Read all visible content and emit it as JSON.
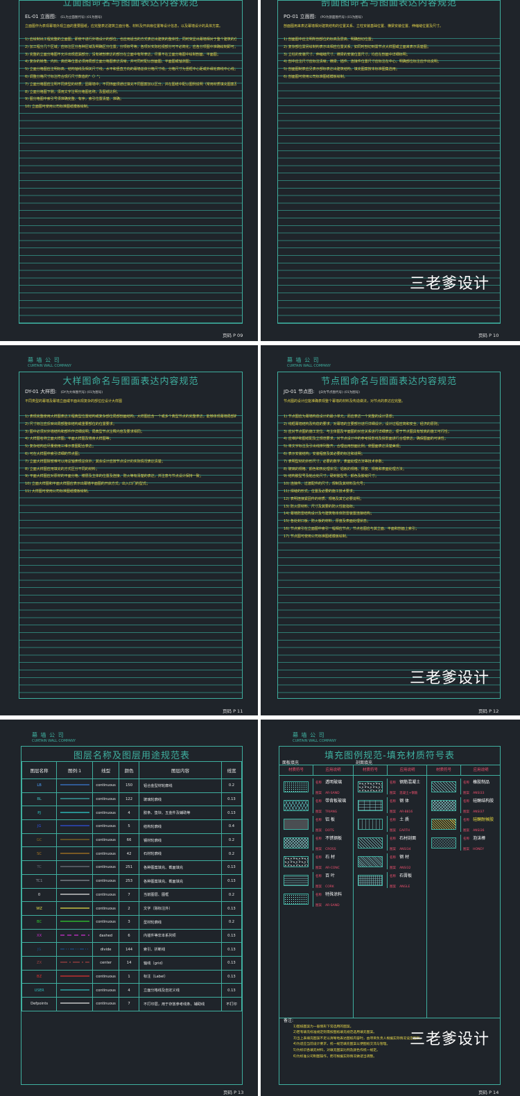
{
  "pages": {
    "p09": {
      "title": "立面图命名与图面表达内容规范",
      "code": "EL-01 立面图:",
      "code_note": "(EL为立面图代号) (01为图号)",
      "intro": "立面图作为表现幕墙外观立面的重要图纸，应完整表达建筑立面分格、材料及开启扇位置等设计信息，以及幕墙设计的具体方案。",
      "items": [
        "1) 应绘制出工程完整的立面图，即使不进行外墙设计的部位，也应用适当的方式表达出建筑的整体性，同时突显出幕墙相对于整个建筑的位置关系；",
        "2) 加工程分几个区域，应标注区分各种区域及明确区分位置，分项标号等，各项对实际检视部分可不必简化，应各分项图中准确绘制即可；",
        "3) 完整的立面分格图不允许出现遗漏部分，没有被剖表达的部分在立面中有所表达，尽量不在立面分格图中绘制剖面、平面图；",
        "4) 复杂的转角、内凹、高低等位置必须用局部立面分格图表达清晰，并可同时配以剖面图、平面图或轴测图；",
        "5) 立面分格图应注明标高、结构轴线及相关尺寸线，水平和竖直方向的幕墙总体分格尺寸线，分格尺寸为竖框中心距或外缘轮廓线中心线；",
        "6) 调整分格尺寸标注符合现行尺寸数值的\"（）\"；",
        "7) 立面分格图应注明不同类型的材质，因幕墙中，不同饰面须通过填充不同图案加以区分，并在图纸中配以图例说明（常用材质填充图案及填充图例规范）；",
        "8) 立面分格图下侧，须用文字注明分格图名称，及图纸比例；",
        "9) 图分格图中索引号须准确完整、有序，索引位置清楚、准确；",
        "10) 立面图可使用公司标准图纸模板绘制。"
      ],
      "page_no": "页码  P 09"
    },
    "p10": {
      "title": "剖面图命名与图面表达内容规范",
      "code": "PO-01 立面图:",
      "code_note": "(PO为剖面图代号) (01为图号)",
      "intro": "剖面图用来表达幕墙相对建筑结构的位置关系、立柱安装基础位置、横梁安装位置、伸缩缝位置及尺寸。",
      "items": [
        "1) 剖面图中应注明所剖部位的标高及层高、明确剖切位置；",
        "2) 复杂部位需另绘制构表示出相应位置关系，如同时剖切到需节点大样图或立面来表示清楚图；",
        "3) 立柱的安装尺寸、伸缩缝尺寸、横梁的安装位置尺寸，均应在剖面中详细标明；",
        "4) 剖中应注尺寸应标注清晰，横梁、插件、连接件位置尺寸应标注在中心，明确部位标注应作出说明；",
        "5) 剖面图制表应见表示部标表达出建筑结构，填充图案按本标准图集选用；",
        "6) 剖面图可使用公司标准图纸模板绘制。"
      ],
      "page_no": "页码  P 10"
    },
    "p11": {
      "company_cn": "幕 墙 公 司",
      "company_en": "CURTAIN WALL COMPANY",
      "title": "大样图命名与图面表达内容规范",
      "code": "DY-01 大样图:",
      "code_note": "(DY为大样图代号) (01为图号)",
      "intro": "不同类型的幕墙及幕墙立面或平面出现复杂的部位应设计大样图",
      "items": [
        "1) 表现完整使用大样图表达工程典型位置结构或复杂部位局部剖面结构，大样图应含一个或多个典型节点的完整表达，能够体现幕墙局部的整体结构；",
        "2) 尺寸标注应反映出局部整体结构或重要部位的位置要求；",
        "3) 图中必须对外墙结构和部件作详细说明，局典型节点注释内容及要求相同；",
        "4) 大样图名称立面大样图，平面大样图及墙身大样图等；",
        "5) 复杂结构应尽量使用三维示意图配合表达；",
        "6) 可在大样图中索引详细的节点图；",
        "7) 立面大样图除较难可以用总轴表现总体外，其余设计应按节点设计的实际情况表达清楚；",
        "8) 立面大样图应用填充的方式区分不同的材料；",
        "9) 平面大样图应对原材的平面分格、楼层及主体的位置及连接、防火等有清楚的表达，并注意与节点设计保持一致；",
        "10) 立面大样图和平面大样图应表示出幕墙平面图的开启方式，出入口门的型式；",
        "11) 大样图可使用公司标准图纸模板绘制。"
      ],
      "page_no": "页码  P 11"
    },
    "p12": {
      "company_cn": "幕 墙 公 司",
      "company_en": "CURTAIN WALL COMPANY",
      "title": "节点图命名与图面表达内容规范",
      "code": "JD-01 节点图:",
      "code_note": "(JD为节点图代号) (01为图号)",
      "intro": "节点图的设计应能准确表现整个幕墙的材料及构造做法，对节点的表达应完整。",
      "items": [
        "1) 节点图应为幕墙构造设计的最小单元，而应表达一个完整的设计思想；",
        "2) 线框幕墙结构及构造的要求，对幕墙的主要部分进行详细设计，设计过程应简和安全、经济的原则；",
        "3) 应对节点图的施工定位、与主体图及平面图的对应关系进行详细表达，便于节点图具有较高的施工可行性；",
        "4) 应维护和图纸配及立规范要求，对节点设计中的参考投影线及投影面进行合理表达，确保图面的可读性；",
        "5) 将文字标注及引出线排列整齐，合理运用剖面比例，使图面表达清楚美观；",
        "6) 表示安装结构，安装程度及其必要的标注和说明；",
        "7) 表明型材的外形尺寸，必要的数字，表面处理方法等技术参数；",
        "8) 玻璃的规格、颜色和热处理状况；铝板的规格、厚度、规格和表面处理方法；",
        "9) 结构胶型号及粘合处尺寸，硬封胶型号、颜色及胶缝尺寸；",
        "10) 连接件、过渡配件的尺寸，规制及其材料及代号；",
        "11) 焊缝的形式，位置及必要的施工技术要求；",
        "12) 表明连接紧固件的材质、规格及其它必要说明；",
        "13) 防火层材料、尺寸及其要的防火性能指标；",
        "14) 幕墙防雷结构设计及与建筑物本体防雷装置连接结构；",
        "15) 各处封口板、防火板的材料，厚度及表面处理状态；",
        "16) 节点索引在立面图中索引一幅相应节点，节点名图应与其立面、平面和剖面上索引；",
        "17) 节点图可使用公司标准图纸模板绘制。"
      ],
      "page_no": "页码  P 12"
    },
    "p13": {
      "company_cn": "幕 墙 公 司",
      "company_en": "CURTAIN WALL COMPANY",
      "title": "图层名称及图层用途规范表",
      "headers": [
        "图层名称",
        "图例:1",
        "线型",
        "颜色",
        "图层内容",
        "线宽"
      ],
      "rows": [
        {
          "name": "LB",
          "name_color": "#4aa0ff",
          "line_color": "#3a7bd5",
          "dash": "solid",
          "linetype": "continuous",
          "color_no": "150",
          "content": "铝合金型材轮廓线",
          "width": "0.2"
        },
        {
          "name": "BL",
          "name_color": "#3fc0c0",
          "line_color": "#3fb0b0",
          "dash": "solid",
          "linetype": "continuous",
          "color_no": "122",
          "content": "玻璃轮廓线",
          "width": "0.13"
        },
        {
          "name": "PJ",
          "name_color": "#2fd0d0",
          "line_color": "#2fd0d0",
          "dash": "solid",
          "linetype": "continuous",
          "color_no": "4",
          "content": "胶条、垫块、五金件及辅助等",
          "width": "0.13"
        },
        {
          "name": "JG",
          "name_color": "#3050e0",
          "line_color": "#3050e0",
          "dash": "solid",
          "linetype": "continuous",
          "color_no": "5",
          "content": "结构轮廓线",
          "width": "0.4"
        },
        {
          "name": "GC",
          "name_color": "#8a6a20",
          "line_color": "#8a6a20",
          "dash": "solid",
          "linetype": "continuous",
          "color_no": "66",
          "content": "钢材轮廓线",
          "width": "0.2"
        },
        {
          "name": "SC",
          "name_color": "#b07a20",
          "line_color": "#b07a20",
          "dash": "solid",
          "linetype": "continuous",
          "color_no": "42",
          "content": "石材轮廓线",
          "width": "0.2"
        },
        {
          "name": "TC",
          "name_color": "#606870",
          "line_color": "#707880",
          "dash": "solid",
          "linetype": "continuous",
          "color_no": "251",
          "content": "各种图案填充、截面填充",
          "width": "0.13"
        },
        {
          "name": "TC1",
          "name_color": "#8a9098",
          "line_color": "#8a9098",
          "dash": "solid",
          "linetype": "continuous",
          "color_no": "253",
          "content": "各种图案填充、截面填充",
          "width": "0.13"
        },
        {
          "name": "0",
          "name_color": "#e8e8e8",
          "line_color": "#e8e8e8",
          "dash": "solid",
          "linetype": "continuous",
          "color_no": "7",
          "content": "当前图层、图框",
          "width": "0.2"
        },
        {
          "name": "WZ",
          "name_color": "#e8e04a",
          "line_color": "#e8e04a",
          "dash": "solid",
          "linetype": "continuous",
          "color_no": "2",
          "content": "文字（除标注外）",
          "width": "0.13"
        },
        {
          "name": "BC",
          "name_color": "#30d030",
          "line_color": "#30d030",
          "dash": "solid",
          "linetype": "continuous",
          "color_no": "3",
          "content": "型材轮廓线",
          "width": "0.2"
        },
        {
          "name": "XX",
          "name_color": "#d030d0",
          "line_color": "#d030d0",
          "dash": "dashed",
          "linetype": "dashed",
          "color_no": "6",
          "content": "内插件等非本系列项",
          "width": "0.13"
        },
        {
          "name": "JG",
          "name_color": "#1a4a80",
          "line_color": "#1a4a80",
          "dash": "divide",
          "linetype": "divide",
          "color_no": "144",
          "content": "索引、折断线",
          "width": "0.13"
        },
        {
          "name": "ZX",
          "name_color": "#a04040",
          "line_color": "#a04040",
          "dash": "center",
          "linetype": "center",
          "color_no": "14",
          "content": "轴线（grid）",
          "width": "0.13"
        },
        {
          "name": "BZ",
          "name_color": "#e03030",
          "line_color": "#e03030",
          "dash": "solid",
          "linetype": "continuous",
          "color_no": "1",
          "content": "标注（Label）",
          "width": "0.13"
        },
        {
          "name": "USER",
          "name_color": "#30c0c0",
          "line_color": "#30c0c0",
          "dash": "solid",
          "linetype": "continuous",
          "color_no": "4",
          "content": "立面分格线及自定义线",
          "width": "0.13"
        },
        {
          "name": "Defpoints",
          "name_color": "#e8e8e8",
          "line_color": "#e8e8e8",
          "dash": "solid",
          "linetype": "continuous",
          "color_no": "7",
          "content": "不打印层，用于存放参考线条、辅助线",
          "width": "不打印"
        }
      ],
      "page_no": "页码  P 13"
    },
    "p14": {
      "company_cn": "幕 墙 公 司",
      "company_en": "CURTAIN WALL COMPANY",
      "title": "填充图例规范-填充材质符号表",
      "sub_left": "面板填充",
      "sub_right": "剖面填充",
      "col_symbol": "材质符号",
      "col_usage": "应用说明",
      "tag_name": "名称",
      "tag_pattern": "图案",
      "col1": [
        {
          "name": "透明玻璃",
          "pattern": "AR-SAND",
          "pat": "dots"
        },
        {
          "name": "带背板玻璃",
          "pattern": "TRIANG",
          "pat": "tri"
        },
        {
          "name": "铝 板",
          "pattern": "DOTS",
          "pat": "fine"
        },
        {
          "name": "不锈钢板",
          "pattern": "CROSS",
          "pat": "cross"
        },
        {
          "name": "石 材",
          "pattern": "AR-CONC",
          "pat": "conc"
        },
        {
          "name": "百 叶",
          "pattern": "CORK",
          "pat": "lines"
        },
        {
          "name": "特殊涂料",
          "pattern": "AR-SAND",
          "pat": "dots"
        }
      ],
      "col2": [
        {
          "name": "钢筋混凝土",
          "pattern": "混凝土+钢筋",
          "pat": "conc"
        },
        {
          "name": "钢 体",
          "pattern": "AR-B816",
          "pat": "brick"
        },
        {
          "name": "土 质",
          "pattern": "EARTH",
          "pat": "earth"
        },
        {
          "name": "石材剖面",
          "pattern": "ANSI34",
          "pat": "diag"
        },
        {
          "name": "钢 材",
          "pattern": "ANSI32",
          "pat": "diag2"
        },
        {
          "name": "石膏板",
          "pattern": "ANGLE",
          "pat": "grid"
        }
      ],
      "col3": [
        {
          "name": "橡胶制品",
          "pattern": "ANSI33",
          "pat": "diag"
        },
        {
          "name": "硅酮结构胶",
          "pattern": "ANSI37",
          "pat": "cross"
        },
        {
          "name": "硅酮耐候胶",
          "pattern": "ANSI36",
          "pat": "yellow"
        },
        {
          "name": "泡沫棒",
          "pattern": "HONEY",
          "pat": "honey"
        }
      ],
      "notes_title": "备注:",
      "notes": [
        "1)图纸图案为一般情形下常选用的图案。",
        "2)若有填充标准规定则需按图纸填充规范选用填充图案。",
        "3)当上表填充图案不足以清晰地表达图纸内容时，由项目负责人根据实际情况设定图案。",
        "4)为适应当前设计要求，统一规范填充图案以便图纸交流与管理。",
        "5)为标识各填充材料，对填充图案比例及颜色作统一规定。",
        "6)为标准公司制图操作，而可根据实际情况做适当调整。"
      ],
      "page_no": "页码  P 14"
    }
  },
  "watermark": "三老爹设计"
}
